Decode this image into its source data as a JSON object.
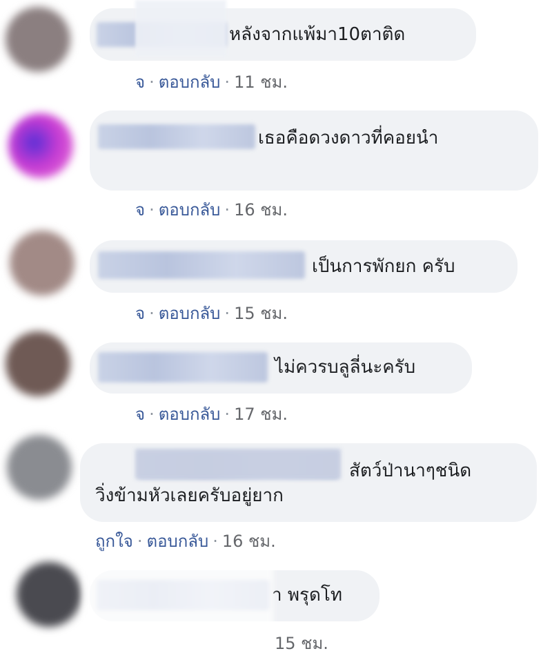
{
  "comments": [
    {
      "text": "หลังจากแพ้มา10ตาติด",
      "like": "จ",
      "reply": "ตอบกลับ",
      "time": "11 ชม.",
      "avatar_color": "#8b7f80"
    },
    {
      "text": "เธอคือดวงดาวที่คอยนำ",
      "like": "จ",
      "reply": "ตอบกลับ",
      "time": "16 ชม.",
      "avatar_color": "#c53bd3"
    },
    {
      "text": "เป็นการพักยก ครับ",
      "like": "จ",
      "reply": "ตอบกลับ",
      "time": "15 ชม.",
      "avatar_color": "#a28a86"
    },
    {
      "text": "ไม่ควรบลูลี่นะครับ",
      "like": "จ",
      "reply": "ตอบกลับ",
      "time": "17 ชม.",
      "avatar_color": "#6f5a55"
    },
    {
      "text_line1": "สัตว์ป่านาๆชนิด",
      "text_line2": "วิ่งข้ามหัวเลยครับอยู่ยาก",
      "like": "ถูกใจ",
      "reply": "ตอบกลับ",
      "time": "16 ชม.",
      "avatar_color": "#8a8c91"
    },
    {
      "text": "า พรุดโท",
      "time": "15 ชม.",
      "avatar_color": "#4a4a50"
    }
  ],
  "colors": {
    "bubble_bg": "#f0f2f5",
    "link": "#385898",
    "meta": "#65676b"
  }
}
